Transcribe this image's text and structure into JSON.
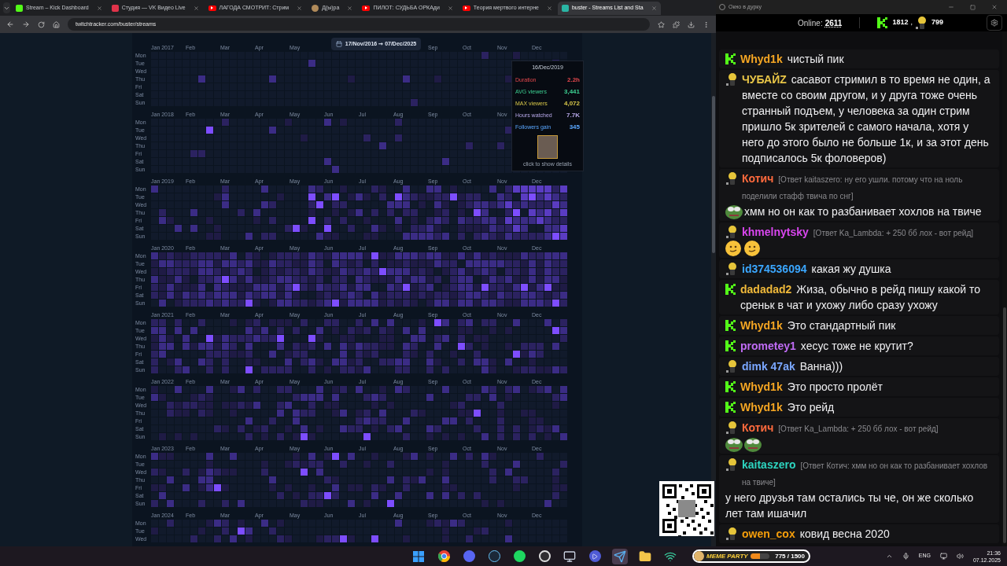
{
  "browser": {
    "tabs": [
      {
        "title": "Stream – Kick Dashboard",
        "kind": "kick",
        "selected": false
      },
      {
        "title": "Студия — VK Видео Live",
        "kind": "vk",
        "selected": false
      },
      {
        "title": "ЛАГОДА СМОТРИТ: Стрим",
        "kind": "video",
        "selected": false
      },
      {
        "title": "Д(ы)ра",
        "kind": "avatar",
        "selected": false
      },
      {
        "title": "ПИЛОТ: СУДЬБА ОРКАди",
        "kind": "video",
        "selected": false
      },
      {
        "title": "Теория мертвого интерне",
        "kind": "video",
        "selected": false
      },
      {
        "title": "buster - Streams List and Sta",
        "kind": "tracker",
        "selected": true
      }
    ],
    "url": "twitchtracker.com/buster/streams"
  },
  "heatmap": {
    "years": [
      {
        "label": "Jan 2017",
        "months": [
          "Feb",
          "Mar",
          "Apr",
          "May"
        ],
        "date_range": "17/Nov/2016 ➞ 07/Dec/2025",
        "months_after": [
          "Sep",
          "Oct",
          "Nov",
          "Dec"
        ],
        "days": [
          "Mon",
          "Tue",
          "Wed",
          "Thu",
          "Fri",
          "Sat",
          "Sun"
        ]
      },
      {
        "label": "Jan 2018",
        "months": [
          "Feb",
          "Mar",
          "Apr",
          "May",
          "Jun",
          "Jul",
          "Aug",
          "Sep",
          "Oct",
          "Nov"
        ],
        "days": [
          "Mon",
          "Tue",
          "Wed",
          "Thu",
          "Fri",
          "Sat",
          "Sun"
        ]
      },
      {
        "label": "Jan 2019",
        "months": [
          "Feb",
          "Mar",
          "Apr",
          "May",
          "Jun",
          "Jul",
          "Aug",
          "Sep",
          "Oct",
          "Nov",
          "Dec"
        ],
        "days": [
          "Mon",
          "Tue",
          "Wed",
          "Thu",
          "Fri",
          "Sat",
          "Sun"
        ]
      },
      {
        "label": "Jan 2020",
        "months": [
          "Feb",
          "Mar",
          "Apr",
          "May",
          "Jun",
          "Jul",
          "Aug",
          "Sep",
          "Oct",
          "Nov",
          "Dec"
        ],
        "days": [
          "Mon",
          "Tue",
          "Wed",
          "Thu",
          "Fri",
          "Sat",
          "Sun"
        ]
      },
      {
        "label": "Jan 2021",
        "months": [
          "Feb",
          "Mar",
          "Apr",
          "May",
          "Jun",
          "Jul",
          "Aug",
          "Sep",
          "Oct",
          "Nov",
          "Dec"
        ],
        "days": [
          "Mon",
          "Tue",
          "Wed",
          "Thu",
          "Fri",
          "Sat",
          "Sun"
        ]
      },
      {
        "label": "Jan 2022",
        "months": [
          "Feb",
          "Mar",
          "Apr",
          "May",
          "Jun",
          "Jul",
          "Aug",
          "Sep",
          "Oct",
          "Nov",
          "Dec"
        ],
        "days": [
          "Mon",
          "Tue",
          "Wed",
          "Thu",
          "Fri",
          "Sat",
          "Sun"
        ]
      },
      {
        "label": "Jan 2023",
        "months": [
          "Feb",
          "Mar",
          "Apr",
          "May",
          "Jun",
          "Jul",
          "Aug",
          "Sep",
          "Oct",
          "Nov",
          "Dec"
        ],
        "days": [
          "Mon",
          "Tue",
          "Wed",
          "Thu",
          "Fri",
          "Sat",
          "Sun"
        ]
      },
      {
        "label": "Jan 2024",
        "months": [
          "Feb",
          "Mar",
          "Apr",
          "May",
          "Jun",
          "Jul",
          "Aug",
          "Sep",
          "Oct",
          "Nov",
          "Dec"
        ],
        "days": [
          "Mon",
          "Tue",
          "Wed"
        ]
      }
    ]
  },
  "tooltip": {
    "date": "16/Dec/2019",
    "stats": [
      {
        "label": "Duration",
        "value": "2.2h",
        "color": "#e5484d"
      },
      {
        "label": "AVG viewers",
        "value": "3,441",
        "color": "#3ccf91"
      },
      {
        "label": "MAX viewers",
        "value": "4,072",
        "color": "#d9c84a"
      },
      {
        "label": "Hours watched",
        "value": "7.7K",
        "color": "#b7a8e8"
      },
      {
        "label": "Followers gain",
        "value": "345",
        "color": "#5aa7ff"
      }
    ],
    "footer": "click to show details"
  },
  "chat": {
    "window_title": "Окно в дурку",
    "online_label": "Online:",
    "online_count": "2611",
    "kick_count": "1812",
    "separator": ",",
    "other_count": "799",
    "messages": [
      {
        "kind": "kick",
        "user": "Whyd1k",
        "color": "#f5a623",
        "text": "чистый пик"
      },
      {
        "kind": "figure",
        "user": "ЧУБАЙZ",
        "color": "#e8c547",
        "text": "сасавот стримил в то время не один, а вместе со своим другом, и у друга тоже очень странный подъем, у человека за один стрим пришло 5к зрителей с самого начала, хотя у него до этого было не больше 1к, и за этот день подписалось 5к фоловеров)"
      },
      {
        "kind": "figure",
        "user": "Котич",
        "color": "#ff6a3d",
        "reply": "[Ответ kaitaszero: ну его ушли. потому что на ноль поделили стафф твича по снг]",
        "emotes": [
          {
            "kind": "frog"
          }
        ],
        "text": "хмм но он как то разбанивает хохлов на твиче"
      },
      {
        "kind": "figure",
        "user": "khmelnytsky",
        "color": "#d946ef",
        "reply": "[Ответ Ka_Lambda: + 250 бб лох - вот рейд]",
        "emotes": [
          {
            "kind": "smirk"
          },
          {
            "kind": "smirk"
          }
        ]
      },
      {
        "kind": "figure",
        "user": "id374536094",
        "color": "#3ba7ff",
        "text": "какая жу душка"
      },
      {
        "kind": "kick",
        "user": "dadadad2",
        "color": "#f0b93a",
        "text": "Жиза, обычно в рейд пишу какой то среньк в чат и ухожу либо сразу ухожу"
      },
      {
        "kind": "kick",
        "user": "Whyd1k",
        "color": "#f5a623",
        "text": "Это стандартный пик"
      },
      {
        "kind": "kick",
        "user": "prometey1",
        "color": "#c06cf5",
        "text": "хесус тоже не крутит?"
      },
      {
        "kind": "figure",
        "user": "dimk 47ak",
        "color": "#7aa7ff",
        "text": "Ванна)))"
      },
      {
        "kind": "kick",
        "user": "Whyd1k",
        "color": "#f5a623",
        "text": "Это просто пролёт"
      },
      {
        "kind": "kick",
        "user": "Whyd1k",
        "color": "#f5a623",
        "text": "Это рейд"
      },
      {
        "kind": "figure",
        "user": "Котич",
        "color": "#ff6a3d",
        "reply": "[Ответ Ka_Lambda: + 250 бб лох - вот рейд]",
        "emotes": [
          {
            "kind": "frog"
          },
          {
            "kind": "frog"
          }
        ]
      },
      {
        "kind": "figure",
        "user": "kaitaszero",
        "color": "#2dd4bf",
        "reply": "[Ответ Котич: хмм но он как то разбанивает хохлов на твиче]",
        "text": "у него друзья там остались ты че, он же сколько лет там ишачил"
      },
      {
        "kind": "figure",
        "user": "owen_cox",
        "color": "#f59e0b",
        "text": "ковид весна 2020"
      }
    ]
  },
  "taskbar": {
    "apps": [
      {
        "kind": "windows",
        "selected": false
      },
      {
        "kind": "browser",
        "selected": false
      },
      {
        "kind": "chat",
        "selected": false
      },
      {
        "kind": "steam",
        "selected": false
      },
      {
        "kind": "music",
        "selected": false
      },
      {
        "kind": "recorder",
        "selected": false
      },
      {
        "kind": "monitor",
        "selected": false
      },
      {
        "kind": "player",
        "selected": false
      },
      {
        "kind": "messenger",
        "selected": true
      },
      {
        "kind": "folder",
        "selected": false
      },
      {
        "kind": "tool",
        "selected": false
      }
    ],
    "widget": {
      "title": "MEME PARTY",
      "count": "775 / 1500",
      "level": 0.517
    },
    "language": "ENG",
    "time": "21:36",
    "date": "07.12.2025"
  }
}
